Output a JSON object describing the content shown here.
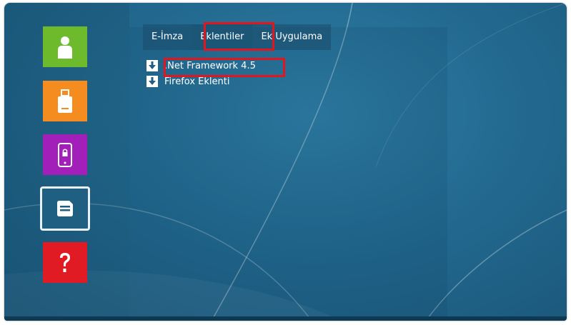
{
  "sidebar": {
    "tiles": [
      {
        "icon": "person-icon",
        "color": "#6dbb2d"
      },
      {
        "icon": "usb-drive-icon",
        "color": "#f58c1f"
      },
      {
        "icon": "mobile-lock-icon",
        "color": "#a31fb9"
      },
      {
        "icon": "document-icon",
        "color": "#1f5f81",
        "selected": true
      },
      {
        "icon": "question-mark-icon",
        "color": "#e01b23"
      }
    ]
  },
  "tabs": [
    {
      "label": "E-İmza"
    },
    {
      "label": "Eklentiler",
      "selected": true
    },
    {
      "label": "Ek Uygulama"
    }
  ],
  "downloads": [
    {
      "label": ".Net Framework 4.5",
      "icon": "download-arrow-icon",
      "highlighted": true
    },
    {
      "label": "Firefox Eklenti",
      "icon": "download-arrow-icon"
    }
  ],
  "colors": {
    "highlight": "#e3151f",
    "background": "#236a90"
  }
}
